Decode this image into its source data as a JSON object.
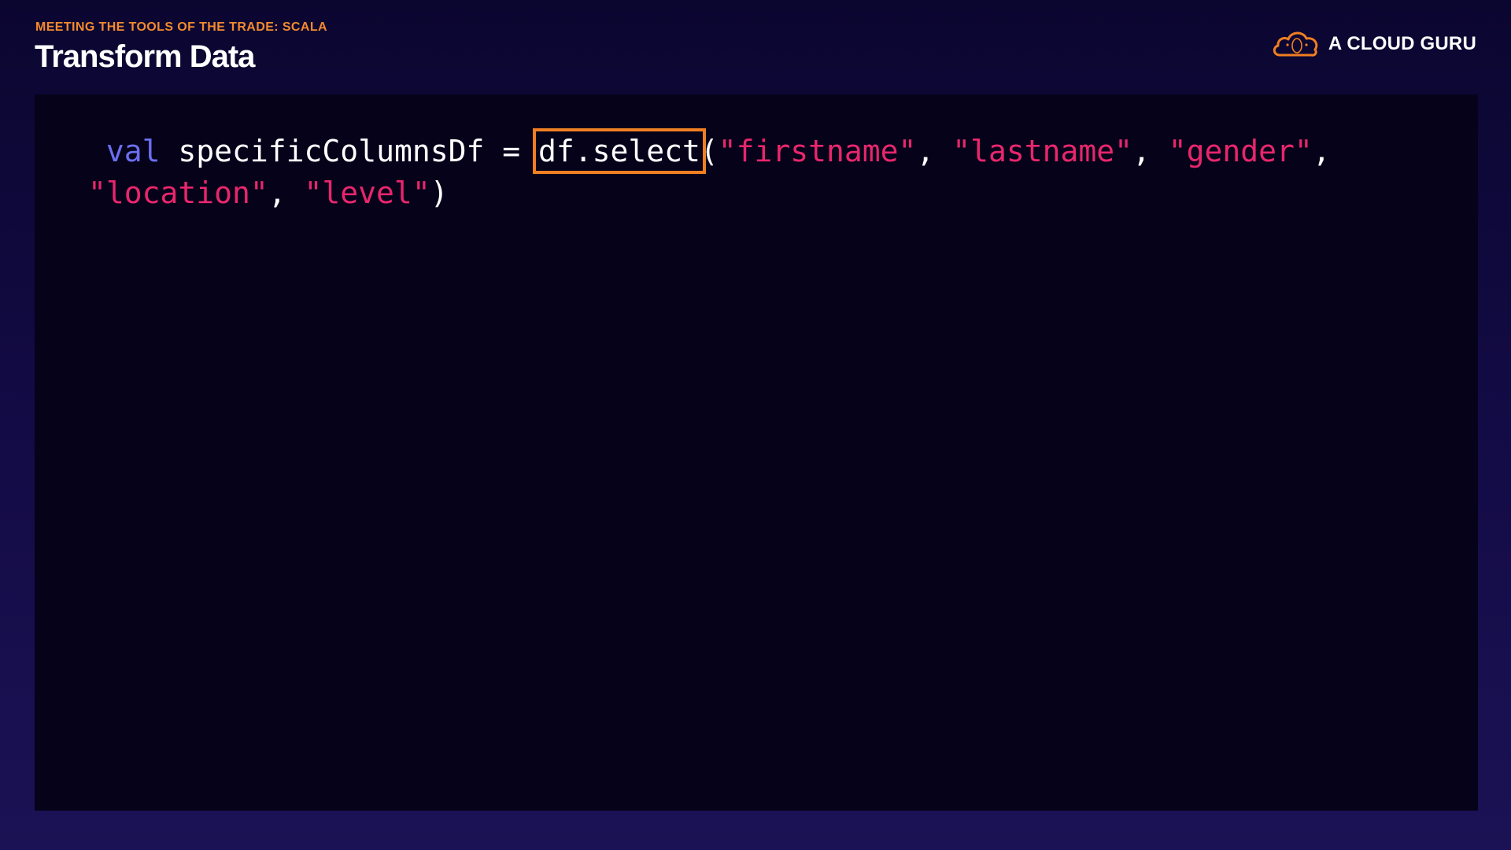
{
  "header": {
    "eyebrow": "MEETING THE TOOLS OF THE TRADE: SCALA",
    "title": "Transform Data"
  },
  "brand": {
    "name": "A CLOUD GURU",
    "logo_icon": "cloud-icon",
    "accent_color": "#f07f22"
  },
  "code": {
    "keyword": "val",
    "variable": " specificColumnsDf = ",
    "highlighted_call": "df.select",
    "open_paren": "(",
    "args": {
      "a1": "\"firstname\"",
      "a2": "\"lastname\"",
      "a3": "\"gender\"",
      "a4": "\"location\"",
      "a5": "\"level\""
    },
    "separator": ", ",
    "trailing_comma": ",",
    "close_paren": ")"
  },
  "colors": {
    "background_top": "#0b0630",
    "background_bottom": "#1b1255",
    "panel": "#05021a",
    "keyword": "#6b6ef0",
    "string": "#e8266c",
    "highlight_box": "#f07f22",
    "eyebrow": "#f38a2e"
  }
}
